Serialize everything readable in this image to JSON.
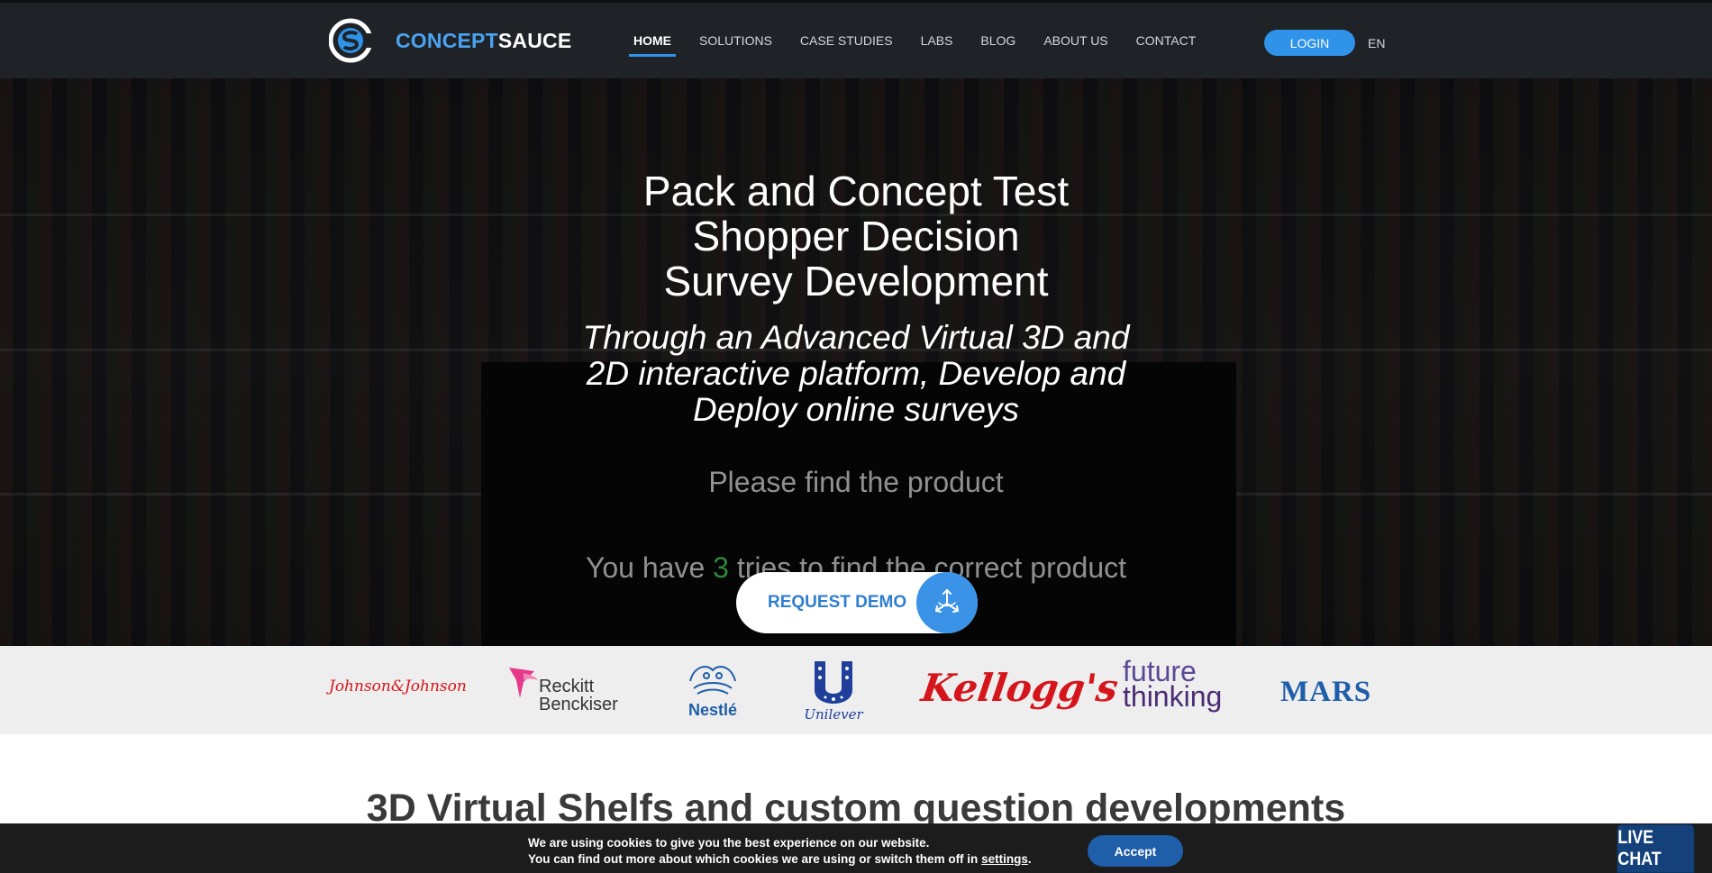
{
  "brand": {
    "name_part1": "CONCEPT",
    "name_part2": "SAUCE"
  },
  "nav": {
    "items": [
      {
        "label": "HOME",
        "active": true
      },
      {
        "label": "SOLUTIONS"
      },
      {
        "label": "CASE STUDIES"
      },
      {
        "label": "LABS"
      },
      {
        "label": "BLOG"
      },
      {
        "label": "ABOUT US"
      },
      {
        "label": "CONTACT"
      }
    ],
    "login_label": "LOGIN",
    "language": "EN"
  },
  "hero": {
    "title_lines": [
      "Pack and Concept Test",
      "Shopper Decision",
      "Survey Development"
    ],
    "subtitle_lines": [
      "Through an Advanced Virtual 3D and",
      "2D interactive platform, Develop and",
      "Deploy online surveys"
    ],
    "background_text_1": "Please find the product",
    "background_text_2_prefix": "You have ",
    "background_text_2_number": "3",
    "background_text_2_suffix": " tries to find the correct product",
    "demo_button_label": "REQUEST DEMO"
  },
  "clients": {
    "johnson": "Johnson&Johnson",
    "reckitt_line1": "Reckitt",
    "reckitt_line2": "Benckiser",
    "nestle": "Nestlé",
    "unilever": "Unilever",
    "kelloggs": "Kellogg's",
    "future_line1": "future",
    "future_line2": "thinking",
    "mars": "MARS"
  },
  "section": {
    "title": "3D Virtual Shelfs and custom question developments"
  },
  "cookie": {
    "line1": "We are using cookies to give you the best experience on our website.",
    "line2_prefix": "You can find out more about which cookies we are using or switch them off in ",
    "line2_link": "settings",
    "line2_suffix": ".",
    "accept_label": "Accept"
  },
  "livechat": {
    "label": "LIVE CHAT"
  },
  "colors": {
    "accent": "#2f93ea",
    "header_bg": "#1f2328",
    "cookie_bg": "#1c1c1c",
    "livechat_bg": "#14417a"
  }
}
